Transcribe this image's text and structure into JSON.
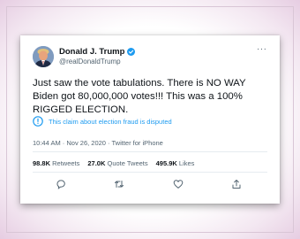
{
  "tweet": {
    "display_name": "Donald J. Trump",
    "handle": "@realDonaldTrump",
    "text": "Just saw the vote tabulations. There is NO WAY Biden got 80,000,000 votes!!! This was a 100% RIGGED ELECTION.",
    "notice": "This claim about election fraud is disputed",
    "meta": "10:44 AM · Nov 26, 2020 · Twitter for iPhone",
    "more_label": "···",
    "stats": {
      "retweets_count": "98.8K",
      "retweets_label": "Retweets",
      "quotes_count": "27.0K",
      "quotes_label": "Quote Tweets",
      "likes_count": "495.9K",
      "likes_label": "Likes"
    }
  },
  "colors": {
    "accent": "#1d9bf0",
    "text": "#0f1419",
    "secondary": "#536471"
  },
  "icons": {
    "verified": "verified-badge-icon",
    "notice": "exclamation-circle-icon",
    "reply": "reply-icon",
    "retweet": "retweet-icon",
    "like": "heart-icon",
    "share": "share-icon"
  }
}
